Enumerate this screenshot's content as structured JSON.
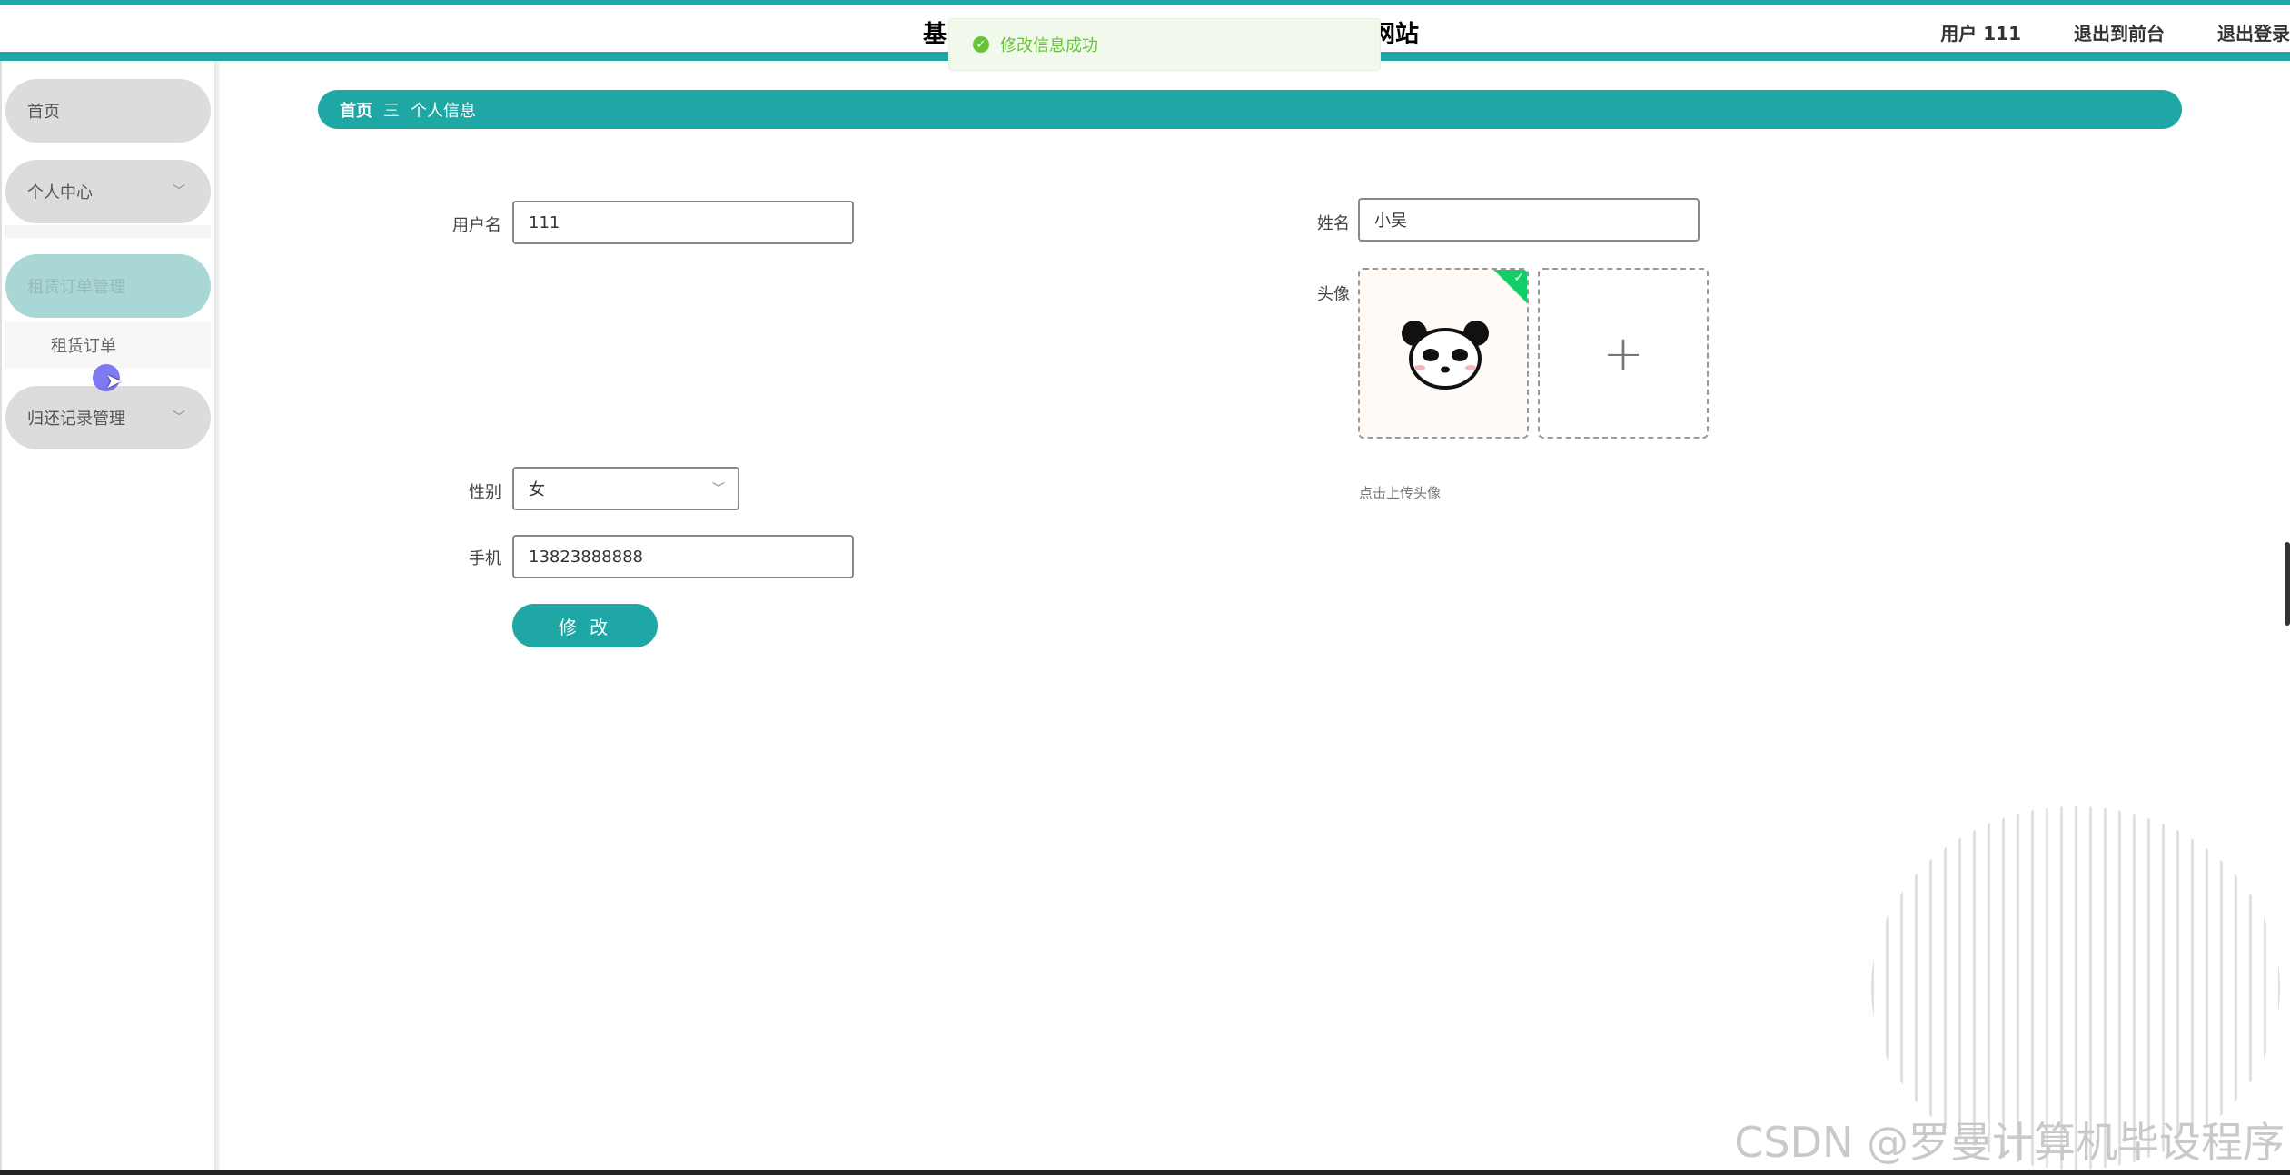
{
  "header": {
    "title_left": "基",
    "title_right": "网站",
    "user_label": "用户 111",
    "back_front": "退出到前台",
    "logout": "退出登录"
  },
  "toast": {
    "message": "修改信息成功",
    "icon": "check-circle-icon"
  },
  "sidebar": {
    "items": [
      {
        "label": "首页"
      },
      {
        "label": "个人中心"
      },
      {
        "label": "租赁订单管理"
      },
      {
        "label": "归还记录管理"
      }
    ],
    "submenu": {
      "label": "租赁订单"
    }
  },
  "breadcrumb": {
    "home": "首页",
    "separator": "三",
    "current": "个人信息"
  },
  "form": {
    "username": {
      "label": "用户名",
      "value": "111"
    },
    "name": {
      "label": "姓名",
      "value": "小吴"
    },
    "avatar": {
      "label": "头像",
      "tip": "点击上传头像",
      "plus": "+"
    },
    "gender": {
      "label": "性别",
      "value": "女"
    },
    "phone": {
      "label": "手机",
      "value": "13823888888"
    },
    "submit": "修 改"
  },
  "watermark": "CSDN @罗曼计算机毕设程序",
  "colors": {
    "accent": "#1ea7a4",
    "success": "#67c23a",
    "sidebar_active": "#a8d7d6"
  }
}
